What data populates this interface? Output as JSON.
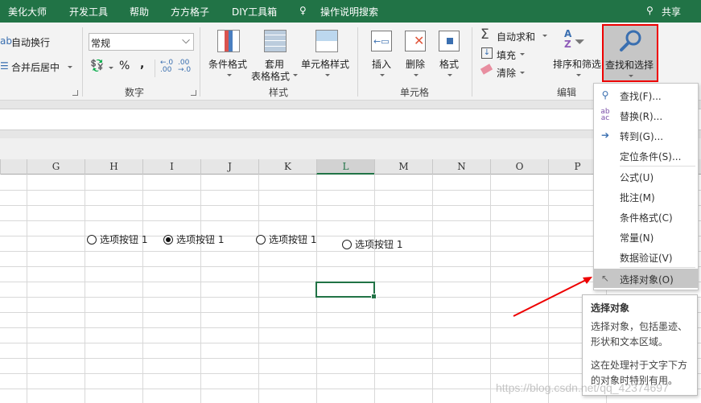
{
  "titlebar": {
    "tabs": [
      "美化大师",
      "开发工具",
      "帮助",
      "方方格子",
      "DIY工具箱",
      "操作说明搜索"
    ],
    "share": "共享",
    "accent": "#217346"
  },
  "ribbon": {
    "alignment": {
      "wrap": "自动换行",
      "merge": "合并后居中"
    },
    "number": {
      "format_value": "常规",
      "percent": "%",
      "comma": ",",
      "label": "数字"
    },
    "styles": {
      "conditional": "条件格式",
      "table_line1": "套用",
      "table_line2": "表格格式",
      "cell_styles": "单元格样式",
      "label": "样式"
    },
    "cells": {
      "insert": "插入",
      "delete": "删除",
      "format": "格式",
      "label": "单元格"
    },
    "editing": {
      "autosum": "自动求和",
      "fill": "填充",
      "clear": "清除",
      "sort": "排序和筛选",
      "find": "查找和选择",
      "label": "编辑"
    }
  },
  "columns": [
    "G",
    "H",
    "I",
    "J",
    "K",
    "L",
    "M",
    "N",
    "O",
    "P"
  ],
  "selected_column": "L",
  "radios": [
    {
      "label": "选项按钮 1",
      "checked": false
    },
    {
      "label": "选项按钮 1",
      "checked": true
    },
    {
      "label": "选项按钮 1",
      "checked": false
    },
    {
      "label": "选项按钮 1",
      "checked": false
    }
  ],
  "menu": {
    "items": [
      {
        "label": "查找(F)...",
        "icon": "search-icon"
      },
      {
        "label": "替换(R)...",
        "icon": "replace-icon"
      },
      {
        "label": "转到(G)...",
        "icon": "arrow-right-icon"
      },
      {
        "label": "定位条件(S)..."
      },
      {
        "label": "公式(U)"
      },
      {
        "label": "批注(M)"
      },
      {
        "label": "条件格式(C)"
      },
      {
        "label": "常量(N)"
      },
      {
        "label": "数据验证(V)"
      },
      {
        "label": "选择对象(O)",
        "icon": "pointer-icon",
        "highlighted": true
      }
    ]
  },
  "tooltip": {
    "title": "选择对象",
    "line1": "选择对象，包括墨迹、形状和文本区域。",
    "line2": "这在处理衬于文字下方的对象时特别有用。"
  },
  "watermark": "https://blog.csdn.net/qq_42374697"
}
